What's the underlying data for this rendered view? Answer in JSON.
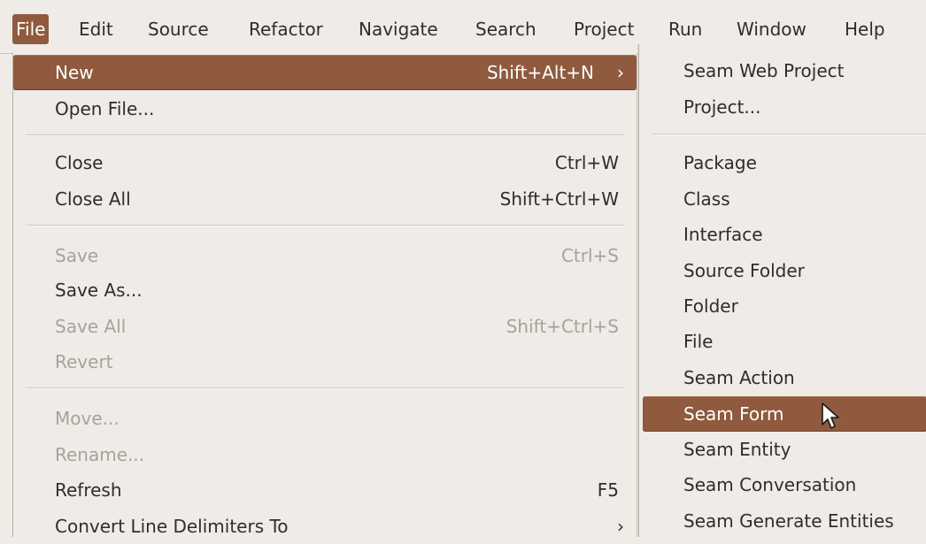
{
  "menubar": {
    "items": [
      {
        "label": "File",
        "active": true
      },
      {
        "label": "Edit"
      },
      {
        "label": "Source"
      },
      {
        "label": "Refactor"
      },
      {
        "label": "Navigate"
      },
      {
        "label": "Search"
      },
      {
        "label": "Project"
      },
      {
        "label": "Run"
      },
      {
        "label": "Window"
      },
      {
        "label": "Help"
      }
    ]
  },
  "file_menu": {
    "new": {
      "label": "New",
      "accel": "Shift+Alt+N",
      "submenu_glyph": "›"
    },
    "open_file": {
      "label": "Open File..."
    },
    "close": {
      "label": "Close",
      "accel": "Ctrl+W"
    },
    "close_all": {
      "label": "Close All",
      "accel": "Shift+Ctrl+W"
    },
    "save": {
      "label": "Save",
      "accel": "Ctrl+S",
      "disabled": true
    },
    "save_as": {
      "label": "Save As..."
    },
    "save_all": {
      "label": "Save All",
      "accel": "Shift+Ctrl+S",
      "disabled": true
    },
    "revert": {
      "label": "Revert",
      "disabled": true
    },
    "move": {
      "label": "Move...",
      "disabled": true
    },
    "rename": {
      "label": "Rename...",
      "disabled": true
    },
    "refresh": {
      "label": "Refresh",
      "accel": "F5"
    },
    "convert_line_delimiters": {
      "label": "Convert Line Delimiters To",
      "submenu_glyph": "›"
    }
  },
  "new_submenu": {
    "items": [
      {
        "label": "Seam Web Project"
      },
      {
        "label": "Project..."
      },
      {
        "label": "Package"
      },
      {
        "label": "Class"
      },
      {
        "label": "Interface"
      },
      {
        "label": "Source Folder"
      },
      {
        "label": "Folder"
      },
      {
        "label": "File"
      },
      {
        "label": "Seam Action"
      },
      {
        "label": "Seam Form",
        "highlighted": true
      },
      {
        "label": "Seam Entity"
      },
      {
        "label": "Seam Conversation"
      },
      {
        "label": "Seam Generate Entities"
      }
    ]
  },
  "colors": {
    "menu_background": "#efebe7",
    "highlight": "#8f5a3e",
    "text": "#2e2e2e",
    "disabled_text": "#a8a29c"
  },
  "icons": {
    "submenu_arrow": "chevron-right-icon",
    "pointer": "mouse-pointer-icon"
  }
}
